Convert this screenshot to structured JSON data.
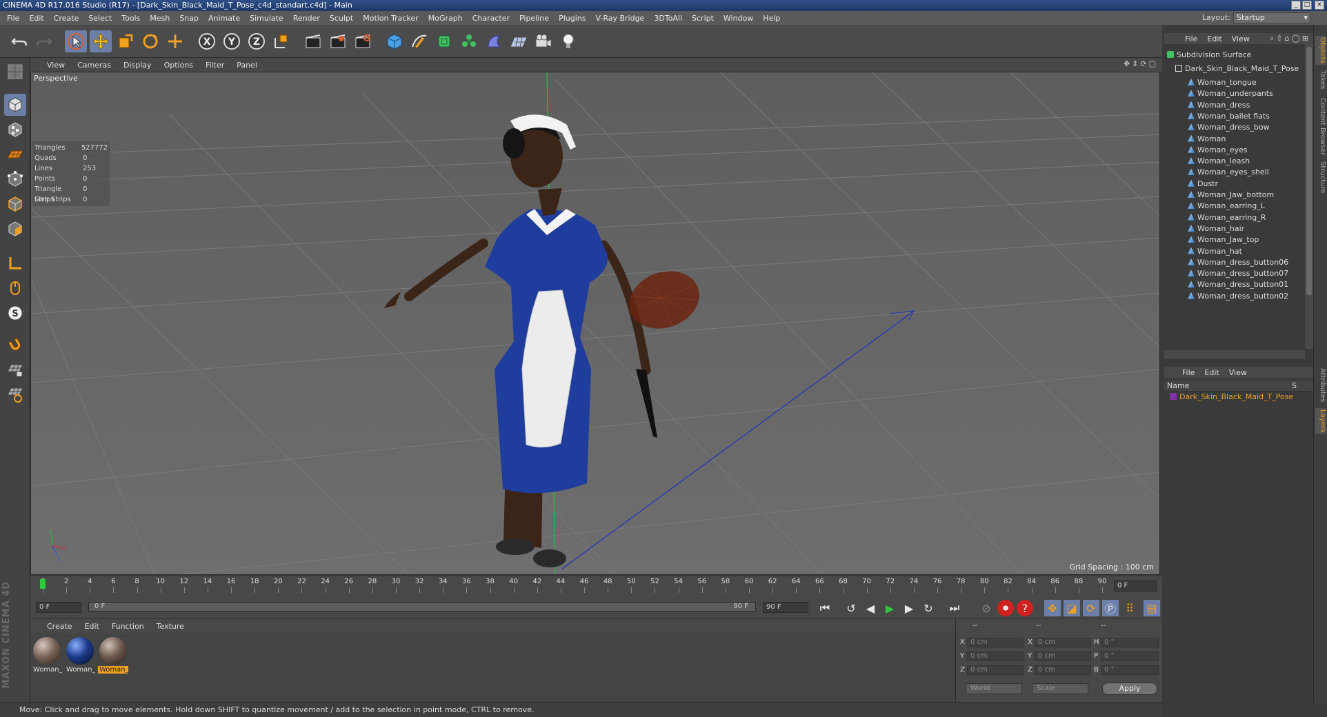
{
  "window": {
    "title": "CINEMA 4D R17.016 Studio (R17) - [Dark_Skin_Black_Maid_T_Pose_c4d_standart.c4d] - Main"
  },
  "menubar": {
    "items": [
      "File",
      "Edit",
      "Create",
      "Select",
      "Tools",
      "Mesh",
      "Snap",
      "Animate",
      "Simulate",
      "Render",
      "Sculpt",
      "Motion Tracker",
      "MoGraph",
      "Character",
      "Pipeline",
      "Plugins",
      "V-Ray Bridge",
      "3DToAll",
      "Script",
      "Window",
      "Help"
    ],
    "layout_label": "Layout:",
    "layout_value": "Startup"
  },
  "viewport": {
    "menu": [
      "View",
      "Cameras",
      "Display",
      "Options",
      "Filter",
      "Panel"
    ],
    "label": "Perspective",
    "grid_spacing": "Grid Spacing : 100 cm",
    "stats": [
      {
        "label": "Triangles",
        "value": "527772"
      },
      {
        "label": "Quads",
        "value": "0"
      },
      {
        "label": "Lines",
        "value": "253"
      },
      {
        "label": "Points",
        "value": "0"
      },
      {
        "label": "Triangle Strips",
        "value": "0"
      },
      {
        "label": "Line Strips",
        "value": "0"
      }
    ]
  },
  "timeline": {
    "ticks": [
      "0",
      "2",
      "4",
      "6",
      "8",
      "10",
      "12",
      "14",
      "16",
      "18",
      "20",
      "22",
      "24",
      "26",
      "28",
      "30",
      "32",
      "34",
      "36",
      "38",
      "40",
      "42",
      "44",
      "46",
      "48",
      "50",
      "52",
      "54",
      "56",
      "58",
      "60",
      "62",
      "64",
      "66",
      "68",
      "70",
      "72",
      "74",
      "76",
      "78",
      "80",
      "82",
      "84",
      "86",
      "88",
      "90"
    ],
    "current_frame": "0 F",
    "start_frame": "0 F",
    "range_start": "0 F",
    "range_end": "90 F",
    "end_frame": "90 F"
  },
  "materials": {
    "menu": [
      "Create",
      "Edit",
      "Function",
      "Texture"
    ],
    "items": [
      {
        "label": "Woman_",
        "color": "#7a6458"
      },
      {
        "label": "Woman_",
        "color": "#1c3a8a"
      },
      {
        "label": "Woman_",
        "color": "#6e5a50"
      }
    ]
  },
  "coords": {
    "header": [
      "--",
      "--",
      "--"
    ],
    "rows": [
      {
        "a": "X",
        "av": "0 cm",
        "b": "X",
        "bv": "0 cm",
        "c": "H",
        "cv": "0 °"
      },
      {
        "a": "Y",
        "av": "0 cm",
        "b": "Y",
        "bv": "0 cm",
        "c": "P",
        "cv": "0 °"
      },
      {
        "a": "Z",
        "av": "0 cm",
        "b": "Z",
        "bv": "0 cm",
        "c": "B",
        "cv": "0 °"
      }
    ],
    "world": "World",
    "scale": "Scale",
    "apply": "Apply"
  },
  "status": "Move: Click and drag to move elements. Hold down SHIFT to quantize movement / add to the selection in point mode, CTRL to remove.",
  "objects": {
    "menu": [
      "File",
      "Edit",
      "View"
    ],
    "root": "Subdivision Surface",
    "group": "Dark_Skin_Black_Maid_T_Pose",
    "children": [
      "Woman_tongue",
      "Woman_underpants",
      "Woman_dress",
      "Woman_ballet flats",
      "Woman_dress_bow",
      "Woman",
      "Woman_eyes",
      "Woman_leash",
      "Woman_eyes_shell",
      "Dustr",
      "Woman_Jaw_bottom",
      "Woman_earring_L",
      "Woman_earring_R",
      "Woman_hair",
      "Woman_Jaw_top",
      "Woman_hat",
      "Woman_dress_button06",
      "Woman_dress_button07",
      "Woman_dress_button01",
      "Woman_dress_button02"
    ]
  },
  "layers": {
    "menu": [
      "File",
      "Edit",
      "View"
    ],
    "col_name": "Name",
    "col_s": "S",
    "row": "Dark_Skin_Black_Maid_T_Pose"
  },
  "vtabs": [
    "Objects",
    "Takes",
    "Content Browser",
    "Structure",
    "Attributes",
    "Layers"
  ],
  "colors": {
    "accent_select": "#6b7fa8",
    "highlight": "#f0a020",
    "play_green": "#2ec93a",
    "record_red": "#d02020"
  }
}
